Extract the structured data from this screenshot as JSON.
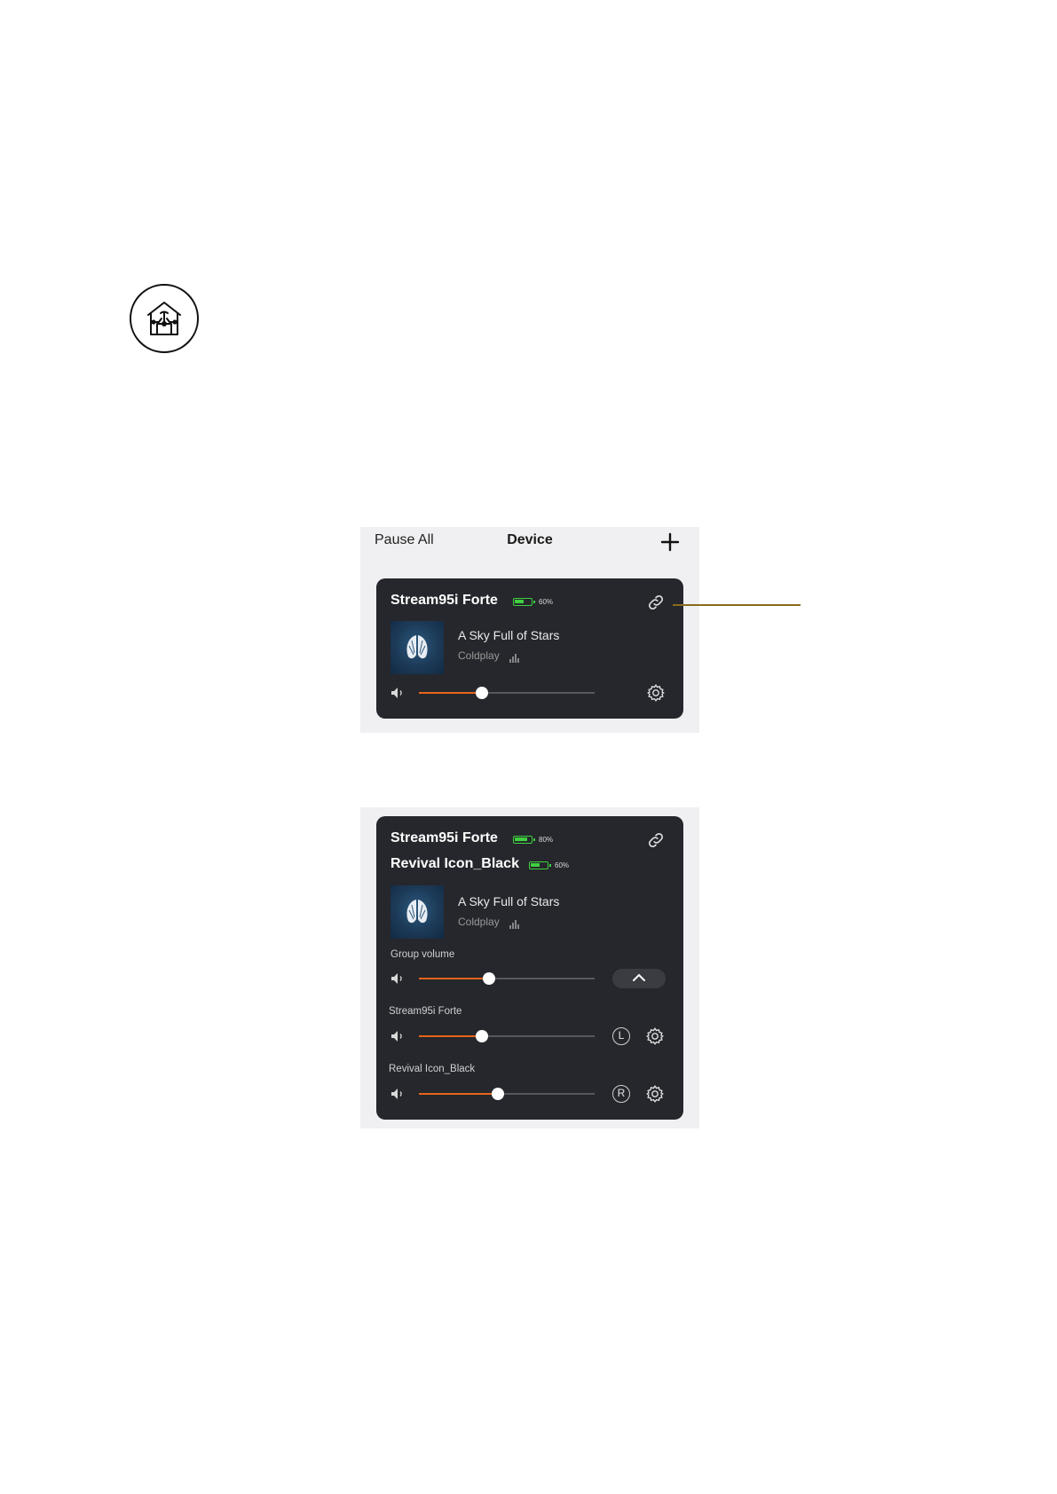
{
  "topbar": {
    "pause_all": "Pause All",
    "title": "Device"
  },
  "card1": {
    "device": {
      "name": "Stream95i Forte",
      "battery_label": "60%",
      "battery_level": 60
    },
    "song": "A Sky Full of Stars",
    "artist": "Coldplay",
    "volume": 0.36
  },
  "card2": {
    "devices": [
      {
        "name": "Stream95i Forte",
        "battery_label": "80%",
        "battery_level": 80
      },
      {
        "name": "Revival Icon_Black",
        "battery_label": "60%",
        "battery_level": 60
      }
    ],
    "song": "A Sky Full of Stars",
    "artist": "Coldplay",
    "group_volume_label": "Group volume",
    "group_volume": 0.4,
    "channels": [
      {
        "label": "Stream95i Forte",
        "badge": "L",
        "volume": 0.36
      },
      {
        "label": "Revival Icon_Black",
        "badge": "R",
        "volume": 0.45
      }
    ]
  },
  "colors": {
    "card_bg": "#25272c",
    "accent": "#e8651a",
    "battery": "#3fcf3f",
    "callout": "#8a6a1e"
  },
  "icons": [
    "home-music-logo-icon",
    "plus-icon",
    "link-icon",
    "speaker-icon",
    "gear-icon",
    "equalizer-bars-icon",
    "chevron-up-icon"
  ]
}
